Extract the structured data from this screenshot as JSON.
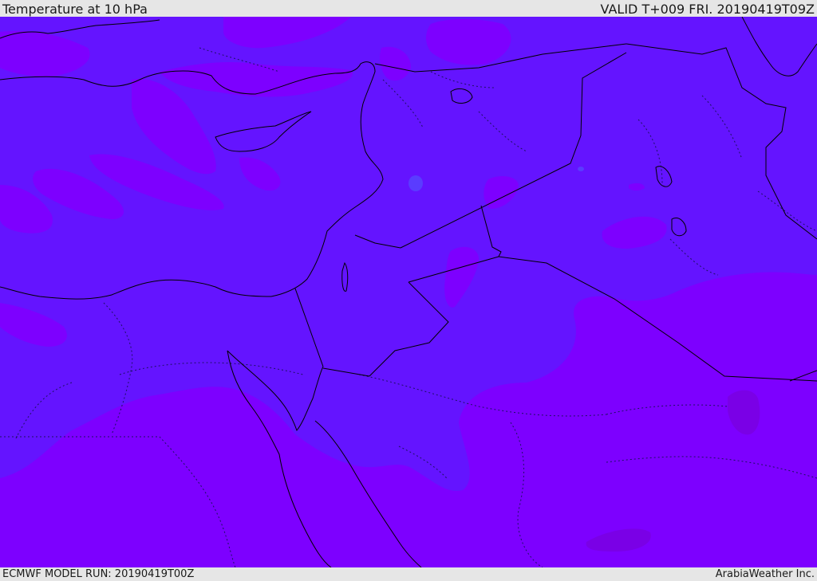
{
  "header": {
    "title": "Temperature at 10 hPa",
    "valid_time": "VALID T+009 FRI. 20190419T09Z"
  },
  "footer": {
    "model_run": "ECMWF MODEL RUN: 20190419T00Z",
    "credit": "ArabiaWeather Inc."
  },
  "colors": {
    "frame": "#e6e6e6",
    "field_base": "#6414ff",
    "field_warm": "#7d00ff",
    "field_warmer": "#7a00e6",
    "field_cool": "#5a3cff",
    "coastline": "#000000"
  },
  "map": {
    "field": "temperature",
    "level": "10 hPa",
    "region": "Eastern Mediterranean and Middle East",
    "features": [
      "coastlines",
      "country borders",
      "province borders (dotted)"
    ]
  }
}
